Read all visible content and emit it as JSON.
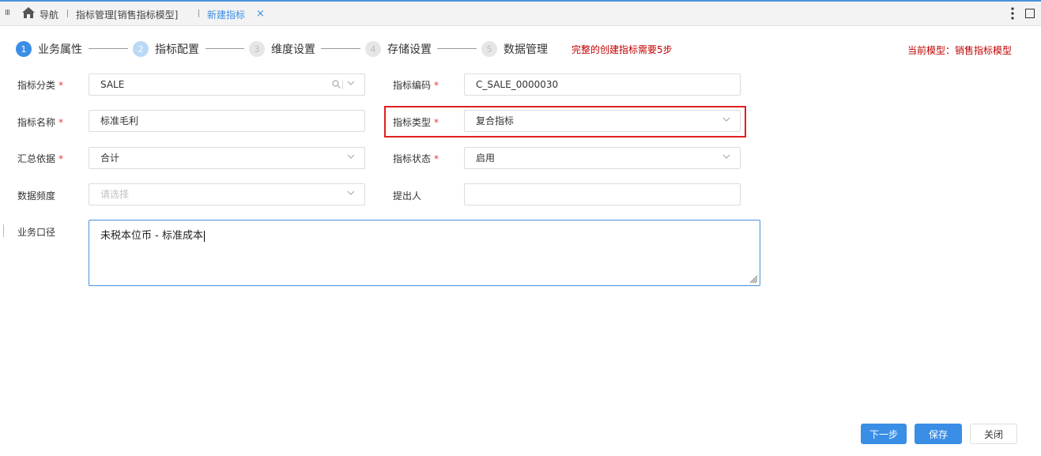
{
  "tabs": {
    "nav_label": "导航",
    "tab1_label": "指标管理[销售指标模型]",
    "tab2_label": "新建指标",
    "close_symbol": "×",
    "grip_symbol": "III"
  },
  "steps": {
    "items": [
      {
        "num": "1",
        "label": "业务属性"
      },
      {
        "num": "2",
        "label": "指标配置"
      },
      {
        "num": "3",
        "label": "维度设置"
      },
      {
        "num": "4",
        "label": "存储设置"
      },
      {
        "num": "5",
        "label": "数据管理"
      }
    ],
    "hint": "完整的创建指标需要5步",
    "current_model": "当前模型：销售指标模型"
  },
  "form": {
    "category": {
      "label": "指标分类",
      "value": "SALE"
    },
    "code": {
      "label": "指标编码",
      "value": "C_SALE_0000030"
    },
    "name": {
      "label": "指标名称",
      "value": "标准毛利"
    },
    "type": {
      "label": "指标类型",
      "value": "复合指标"
    },
    "aggregation": {
      "label": "汇总依据",
      "value": "合计"
    },
    "status": {
      "label": "指标状态",
      "value": "启用"
    },
    "frequency": {
      "label": "数据频度",
      "placeholder": "请选择"
    },
    "proposer": {
      "label": "提出人",
      "value": ""
    },
    "business_caliber": {
      "label": "业务口径",
      "value": "未税本位币 - 标准成本"
    },
    "required_mark": "*"
  },
  "buttons": {
    "next": "下一步",
    "save": "保存",
    "close": "关闭"
  },
  "colors": {
    "accent": "#3a8ee6",
    "required": "#e4393c",
    "hint_red": "#c00000",
    "highlight": "#e02020"
  }
}
